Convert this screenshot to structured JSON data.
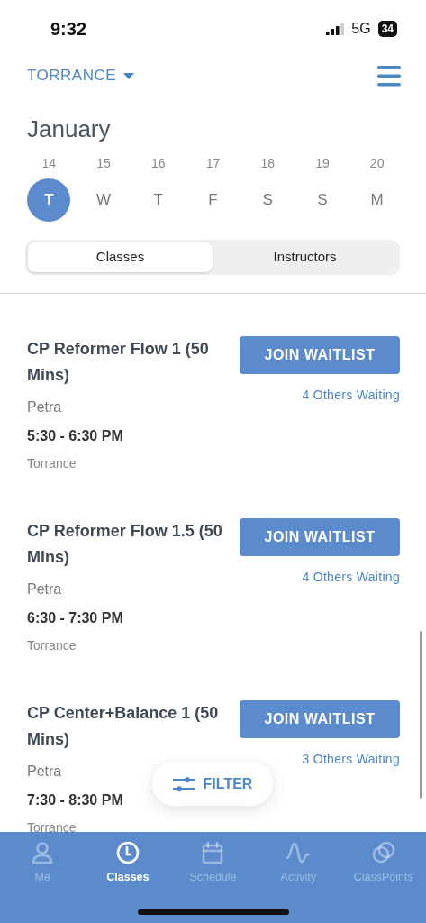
{
  "status_bar": {
    "time": "9:32",
    "network": "5G",
    "battery": "34"
  },
  "location": {
    "label": "TORRANCE"
  },
  "month": "January",
  "days": [
    {
      "date": "14",
      "weekday": "T",
      "selected": true
    },
    {
      "date": "15",
      "weekday": "W",
      "selected": false
    },
    {
      "date": "16",
      "weekday": "T",
      "selected": false
    },
    {
      "date": "17",
      "weekday": "F",
      "selected": false
    },
    {
      "date": "18",
      "weekday": "S",
      "selected": false
    },
    {
      "date": "19",
      "weekday": "S",
      "selected": false
    },
    {
      "date": "20",
      "weekday": "M",
      "selected": false
    }
  ],
  "segments": [
    {
      "label": "Classes",
      "selected": true
    },
    {
      "label": "Instructors",
      "selected": false
    }
  ],
  "classes": [
    {
      "title": "CP Reformer Flow 1 (50 Mins)",
      "instructor": "Petra",
      "time": "5:30 - 6:30 PM",
      "location": "Torrance",
      "action": "JOIN WAITLIST",
      "waiting": "4 Others Waiting"
    },
    {
      "title": "CP Reformer Flow 1.5 (50 Mins)",
      "instructor": "Petra",
      "time": "6:30 - 7:30 PM",
      "location": "Torrance",
      "action": "JOIN WAITLIST",
      "waiting": "4 Others Waiting"
    },
    {
      "title": "CP Center+Balance 1 (50 Mins)",
      "instructor": "Petra",
      "time": "7:30 - 8:30 PM",
      "location": "Torrance",
      "action": "JOIN WAITLIST",
      "waiting": "3 Others Waiting"
    }
  ],
  "filter": {
    "label": "FILTER"
  },
  "tabs": [
    {
      "label": "Me",
      "selected": false
    },
    {
      "label": "Classes",
      "selected": true
    },
    {
      "label": "Schedule",
      "selected": false
    },
    {
      "label": "Activity",
      "selected": false
    },
    {
      "label": "ClassPoints",
      "selected": false
    }
  ]
}
